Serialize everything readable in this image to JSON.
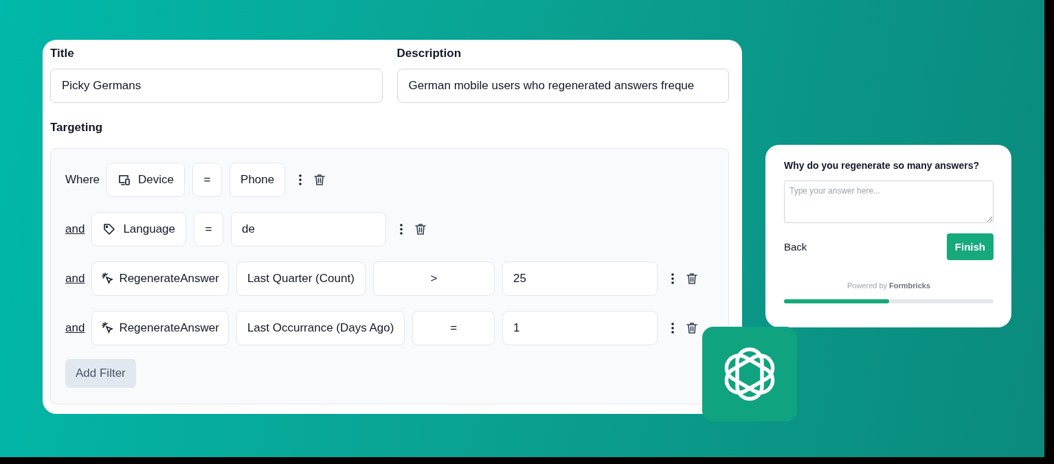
{
  "form": {
    "title": {
      "label": "Title",
      "value": "Picky Germans"
    },
    "description": {
      "label": "Description",
      "value": "German mobile users who regenerated answers freque"
    },
    "targeting": {
      "label": "Targeting",
      "filters": [
        {
          "connector": {
            "kind": "label",
            "text": "Where"
          },
          "items": [
            {
              "kind": "device-attribute",
              "text": "Device"
            },
            {
              "kind": "operator",
              "text": "="
            },
            {
              "kind": "select",
              "text": "Phone"
            }
          ]
        },
        {
          "connector": {
            "kind": "link",
            "text": "and"
          },
          "items": [
            {
              "kind": "tag-attribute",
              "text": "Language"
            },
            {
              "kind": "operator",
              "text": "="
            },
            {
              "kind": "input",
              "text": "de"
            }
          ]
        },
        {
          "connector": {
            "kind": "link",
            "text": "and"
          },
          "items": [
            {
              "kind": "event-attribute",
              "text": "RegenerateAnswer"
            },
            {
              "kind": "select",
              "text": "Last Quarter (Count)"
            },
            {
              "kind": "wide-operator",
              "text": ">"
            },
            {
              "kind": "input",
              "text": "25"
            }
          ]
        },
        {
          "connector": {
            "kind": "link",
            "text": "and"
          },
          "items": [
            {
              "kind": "event-attribute",
              "text": "RegenerateAnswer"
            },
            {
              "kind": "select",
              "text": "Last Occurrance (Days Ago)"
            },
            {
              "kind": "wide-operator",
              "text": "="
            },
            {
              "kind": "input",
              "text": "1"
            }
          ]
        }
      ],
      "add_button": "Add Filter"
    }
  },
  "survey": {
    "question": "Why do you regenerate so many answers?",
    "placeholder": "Type your answer here...",
    "back": "Back",
    "finish": "Finish",
    "powered_by": "Powered by **Formbricks**",
    "progress": {
      "level": 0.5
    }
  }
}
